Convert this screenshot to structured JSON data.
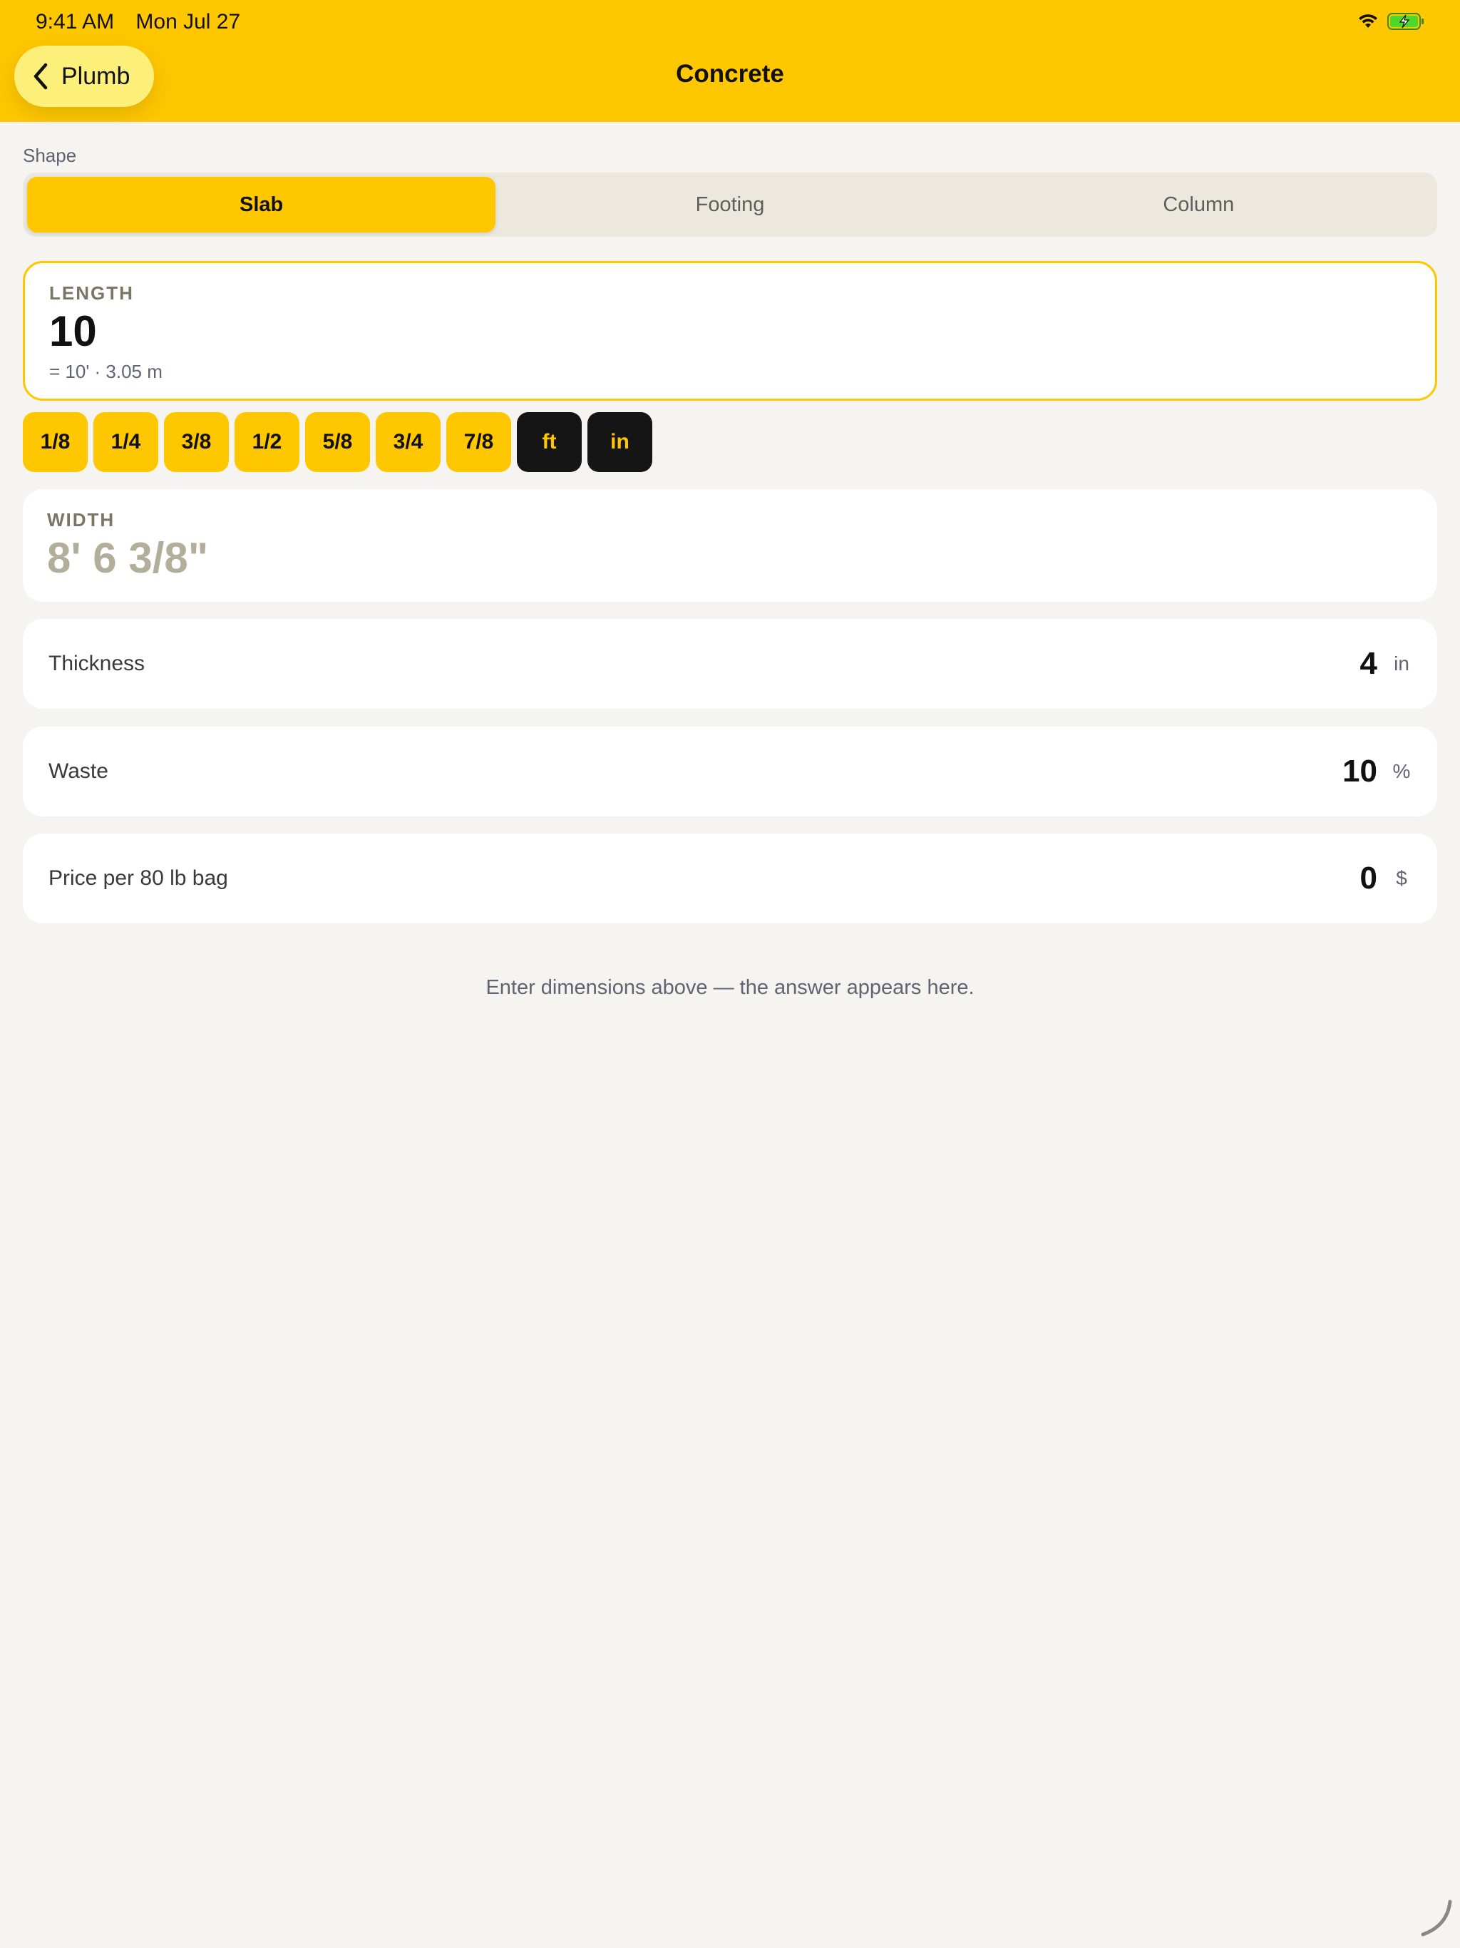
{
  "status_bar": {
    "time": "9:41 AM",
    "date": "Mon Jul 27"
  },
  "nav": {
    "back_label": "Plumb",
    "title": "Concrete"
  },
  "shape": {
    "label": "Shape",
    "segments": [
      "Slab",
      "Footing",
      "Column"
    ],
    "selected": "Slab"
  },
  "length": {
    "label": "LENGTH",
    "value": "10",
    "conversion": "= 10' · 3.05 m"
  },
  "chips": {
    "fractions": [
      "1/8",
      "1/4",
      "3/8",
      "1/2",
      "5/8",
      "3/4",
      "7/8"
    ],
    "units": [
      "ft",
      "in"
    ]
  },
  "width": {
    "label": "WIDTH",
    "placeholder": "8' 6 3/8\""
  },
  "rows": {
    "thickness": {
      "label": "Thickness",
      "value": "4",
      "unit": "in"
    },
    "waste": {
      "label": "Waste",
      "value": "10",
      "unit": "%"
    },
    "price": {
      "label": "Price per 80 lb bag",
      "value": "0",
      "unit": "$"
    }
  },
  "hint": "Enter dimensions above — the answer appears here.",
  "colors": {
    "accent": "#ffc700",
    "background": "#f5f4f0",
    "chip_dark": "#151515"
  },
  "icons": {
    "back": "chevron-left-icon",
    "wifi": "wifi-icon",
    "battery": "battery-charging-icon"
  }
}
